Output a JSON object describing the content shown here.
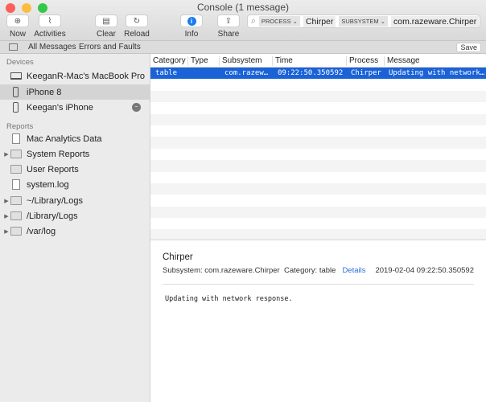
{
  "window": {
    "title": "Console (1 message)"
  },
  "toolbar": {
    "now": "Now",
    "activities": "Activities",
    "clear": "Clear",
    "reload": "Reload",
    "info": "Info",
    "share": "Share"
  },
  "search": {
    "token1": "PROCESS ⌄",
    "value1": "Chirper",
    "token2": "SUBSYSTEM ⌄",
    "value2": "com.razeware.Chirper"
  },
  "filterbar": {
    "all": "All Messages",
    "errors": "Errors and Faults",
    "save": "Save"
  },
  "sidebar": {
    "devices_header": "Devices",
    "devices": [
      "KeeganR-Mac's MacBook Pro",
      "iPhone 8",
      "Keegan's iPhone"
    ],
    "reports_header": "Reports",
    "reports": [
      "Mac Analytics Data",
      "System Reports",
      "User Reports",
      "system.log",
      "~/Library/Logs",
      "/Library/Logs",
      "/var/log"
    ]
  },
  "table": {
    "columns": [
      "Category",
      "Type",
      "Subsystem",
      "Time",
      "Process",
      "Message"
    ],
    "row": {
      "category": "table",
      "type": "",
      "subsystem": "com.razew…",
      "time": "09:22:50.350592",
      "process": "Chirper",
      "message": "Updating with network…"
    }
  },
  "detail": {
    "process": "Chirper",
    "subsystem": "Subsystem: com.razeware.Chirper",
    "category": "Category: table",
    "details": "Details",
    "timestamp": "2019-02-04 09:22:50.350592",
    "message": "Updating with network response."
  }
}
